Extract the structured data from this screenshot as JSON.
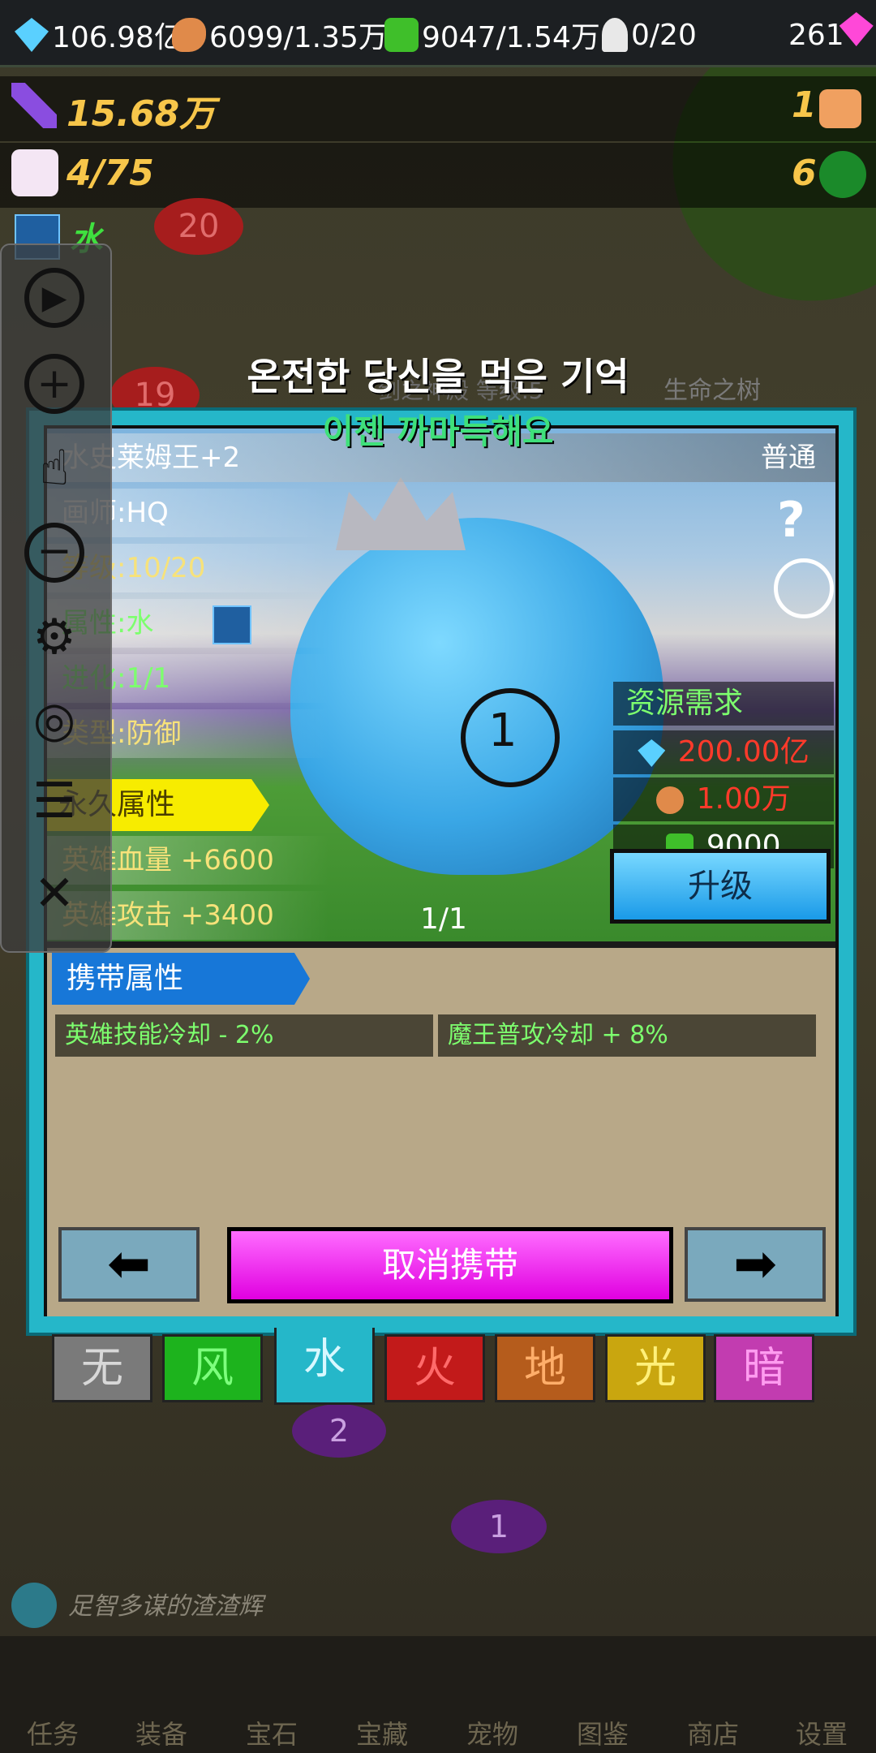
{
  "topbar": {
    "diamonds": "106.98亿",
    "meat": "6099/1.35万",
    "gems": "9047/1.54万",
    "ghost": "0/20",
    "pink_gem": "261"
  },
  "stats": {
    "power": "15.68万",
    "monsters": "4/75",
    "element": "水",
    "right_count_1": "1",
    "right_count_2": "6"
  },
  "map_labels": {
    "badge_20": "20",
    "badge_19": "19",
    "temple": "剑之神殿 等级.5",
    "tree": "生命之树",
    "badge_2": "2",
    "badge_1": "1"
  },
  "overlay": {
    "korean_title": "온전한 당신을 먹은 기억",
    "korean_sub": "이젠 까마득해요"
  },
  "card": {
    "name": "水史莱姆王+2",
    "rarity": "普通",
    "artist": "画师:HQ",
    "level": "等级:10/20",
    "attribute": "属性:水",
    "evolution": "进化:1/1",
    "type": "类型:防御",
    "permanent_tag": "永久属性",
    "hero_hp": "英雄血量 +6600",
    "hero_atk": "英雄攻击 +3400",
    "page": "1/1",
    "crosshair_num": "1",
    "help_mark": "?",
    "resource_title": "资源需求",
    "cost_diamond": "200.00亿",
    "cost_meat": "1.00万",
    "cost_gem": "9000",
    "upgrade_label": "升级",
    "colors": {
      "cost_red": "#ff3a2a",
      "accent_cyan": "#25b7c9",
      "magenta": "#e000e0"
    }
  },
  "carry": {
    "tag": "携带属性",
    "attr1": "英雄技能冷却 - 2%",
    "attr2": "魔王普攻冷却 + 8%",
    "cancel_label": "取消携带",
    "prev_icon": "arrow-left-icon",
    "next_icon": "arrow-right-icon"
  },
  "elements": [
    {
      "label": "无",
      "bg": "#7a7a7a",
      "fg": "#d8d8d8"
    },
    {
      "label": "风",
      "bg": "#1db31d",
      "fg": "#7dff7d"
    },
    {
      "label": "水",
      "bg": "#25b7c9",
      "fg": "#d8f8ff"
    },
    {
      "label": "火",
      "bg": "#c21a1a",
      "fg": "#ff6a6a"
    },
    {
      "label": "地",
      "bg": "#b55c1c",
      "fg": "#ffae6a"
    },
    {
      "label": "光",
      "bg": "#c9a60f",
      "fg": "#fff07a"
    },
    {
      "label": "暗",
      "bg": "#c23cb0",
      "fg": "#ff9cf0"
    }
  ],
  "hint": "足智多谋的渣渣辉",
  "nav": [
    "任务",
    "装备",
    "宝石",
    "宝藏",
    "宠物",
    "图鉴",
    "商店",
    "设置"
  ]
}
